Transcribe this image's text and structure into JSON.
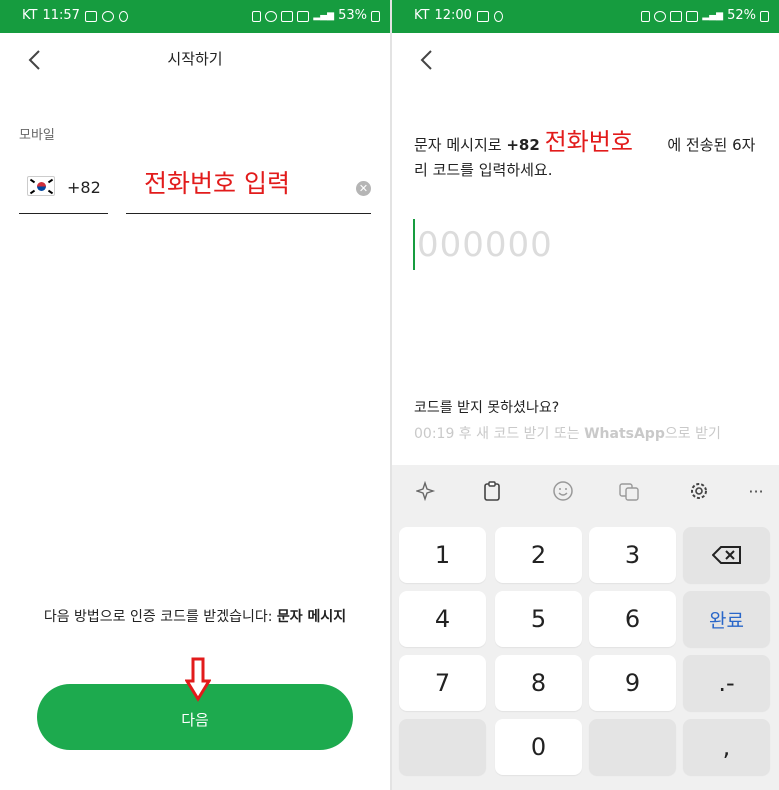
{
  "left": {
    "status": {
      "carrier": "KT",
      "time": "11:57",
      "battery": "53%"
    },
    "title": "시작하기",
    "mobile_label": "모바일",
    "country_code": "+82",
    "phone_note": "전화번호 입력",
    "method_text": "다음 방법으로 인증 코드를 받겠습니다: ",
    "method_bold": "문자 메시지",
    "next_label": "다음"
  },
  "right": {
    "status": {
      "carrier": "KT",
      "time": "12:00",
      "battery": "52%"
    },
    "sms_prefix": "문자 메시지로 ",
    "sms_number": "+82",
    "sms_note": "전화번호",
    "sms_suffix": " 에 전송된 6자리 코드를 입력하세요.",
    "code_placeholder": "000000",
    "no_code": "코드를 받지 못하셨나요?",
    "resend_prefix": "00:19 후 새 코드 받기 또는 ",
    "resend_bold": "WhatsApp",
    "resend_suffix": "으로 받기",
    "keys": {
      "k1": "1",
      "k2": "2",
      "k3": "3",
      "k4": "4",
      "k5": "5",
      "k6": "6",
      "done": "완료",
      "k7": "7",
      "k8": "8",
      "k9": "9",
      "punct": ".-",
      "k0": "0",
      "comma": ","
    },
    "toolbar_more": "···"
  },
  "colors": {
    "accent": "#1daa4e",
    "status_bar": "#169c3f",
    "annotation": "#e21b1b",
    "done_key": "#2a67c9"
  }
}
